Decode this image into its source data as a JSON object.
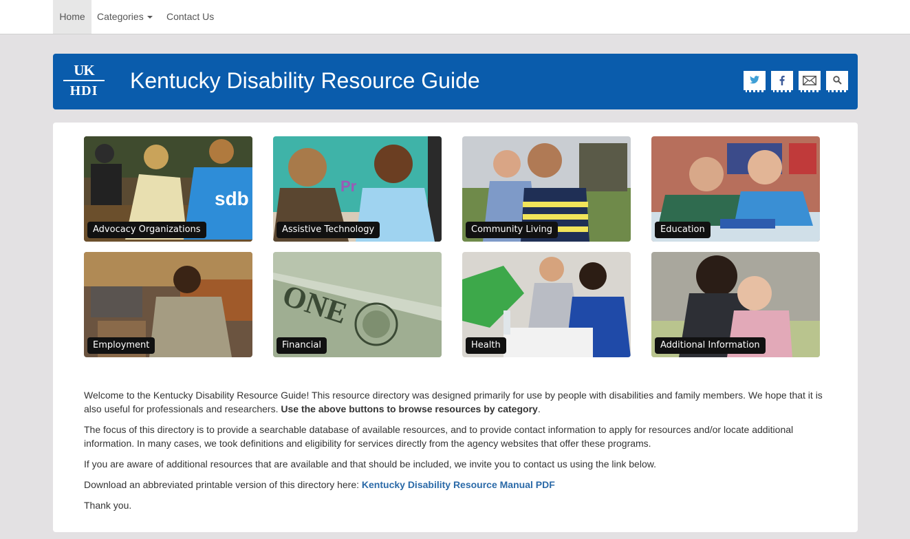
{
  "nav": {
    "home": "Home",
    "categories": "Categories",
    "contact": "Contact Us"
  },
  "header": {
    "logo_top": "UK",
    "logo_bottom": "HDI",
    "title": "Kentucky Disability Resource Guide",
    "icons": [
      "twitter-icon",
      "facebook-icon",
      "email-icon",
      "search-icon"
    ],
    "color": "#0a5cac"
  },
  "tiles": [
    {
      "label": "Advocacy Organizations"
    },
    {
      "label": "Assistive Technology"
    },
    {
      "label": "Community Living"
    },
    {
      "label": "Education"
    },
    {
      "label": "Employment"
    },
    {
      "label": "Financial"
    },
    {
      "label": "Health"
    },
    {
      "label": "Additional Information"
    }
  ],
  "content": {
    "p1_text": "Welcome to the Kentucky Disability Resource Guide! This resource directory was designed primarily for use by people with disabilities and family members. We hope that it is also useful for professionals and researchers. ",
    "p1_bold": "Use the above buttons to browse resources by category",
    "p1_end": ".",
    "p2": "The focus of this directory is to provide a searchable database of available resources, and to provide contact information to apply for resources and/or locate additional information. In many cases, we took definitions and eligibility for services directly from the agency websites that offer these programs.",
    "p3": "If you are aware of additional resources that are available and that should be included, we invite you to contact us using the link below.",
    "p4_text": "Download an abbreviated printable version of this directory here: ",
    "p4_link": "Kentucky Disability Resource Manual PDF",
    "p5": "Thank you."
  }
}
